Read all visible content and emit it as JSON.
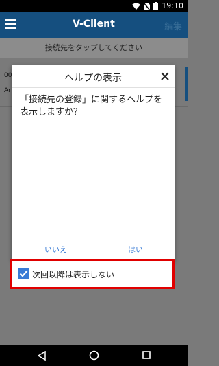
{
  "status_bar": {
    "time": "19:10"
  },
  "app_bar": {
    "title": "V-Client",
    "edit_label": "編集"
  },
  "subheader": {
    "text": "接続先をタップしてください"
  },
  "background_list": {
    "item_id": "00",
    "item_sub": "Ar"
  },
  "dialog": {
    "title": "ヘルプの表示",
    "message": "「接続先の登録」に関するヘルプを表示しますか？",
    "no_label": "いいえ",
    "yes_label": "はい"
  },
  "checkbox": {
    "label": "次回以降は表示しない",
    "checked": true
  },
  "colors": {
    "app_bar": "#154f7f",
    "accent": "#3a7bd5",
    "highlight": "#e00000"
  }
}
